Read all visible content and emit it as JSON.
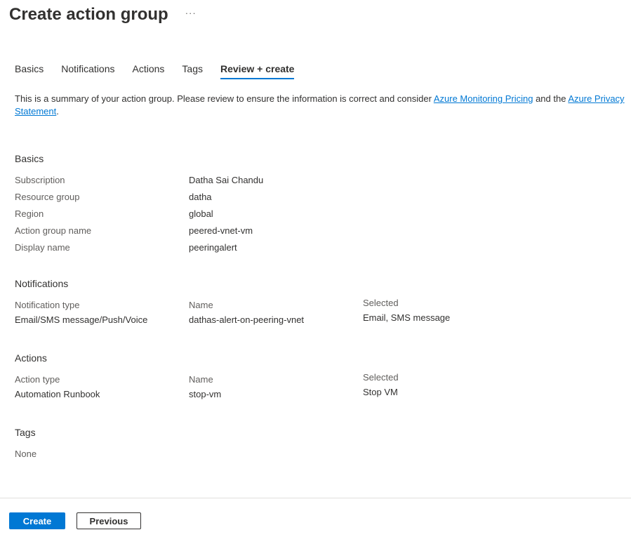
{
  "header": {
    "title": "Create action group",
    "more_label": "···"
  },
  "tabs": [
    {
      "label": "Basics"
    },
    {
      "label": "Notifications"
    },
    {
      "label": "Actions"
    },
    {
      "label": "Tags"
    },
    {
      "label": "Review + create"
    }
  ],
  "active_tab": "Review + create",
  "summary": {
    "text_before": "This is a summary of your action group. Please review to ensure the information is correct and consider ",
    "link1": "Azure Monitoring Pricing",
    "text_middle": " and the ",
    "link2": "Azure Privacy Statement",
    "text_after": "."
  },
  "basics": {
    "title": "Basics",
    "rows": [
      {
        "label": "Subscription",
        "value": "Datha Sai Chandu"
      },
      {
        "label": "Resource group",
        "value": "datha"
      },
      {
        "label": "Region",
        "value": "global"
      },
      {
        "label": "Action group name",
        "value": "peered-vnet-vm"
      },
      {
        "label": "Display name",
        "value": "peeringalert"
      }
    ]
  },
  "notifications": {
    "title": "Notifications",
    "headers": [
      "Notification type",
      "Name",
      "Selected"
    ],
    "row": [
      "Email/SMS message/Push/Voice",
      "dathas-alert-on-peering-vnet",
      "Email, SMS message"
    ]
  },
  "actions": {
    "title": "Actions",
    "headers": [
      "Action type",
      "Name",
      "Selected"
    ],
    "row": [
      "Automation Runbook",
      "stop-vm",
      "Stop VM"
    ]
  },
  "tags": {
    "title": "Tags",
    "value": "None"
  },
  "footer": {
    "create_label": "Create",
    "previous_label": "Previous"
  },
  "colors": {
    "accent": "#0078d4",
    "text": "#323130",
    "muted": "#605e5c"
  }
}
